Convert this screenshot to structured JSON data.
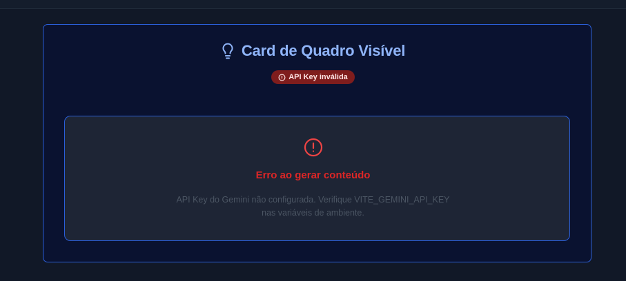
{
  "header": {
    "title": "Card de Quadro Visível",
    "title_icon": "lightbulb-icon"
  },
  "status_badge": {
    "label": "API Key inválida",
    "icon": "alert-circle-icon",
    "color": "#7f1d1d"
  },
  "error": {
    "icon": "alert-circle-icon",
    "title": "Erro ao gerar conteúdo",
    "message_line1": "API Key do Gemini não configurada. Verifique VITE_GEMINI_API_KEY",
    "message_line2": "nas variáveis de ambiente.",
    "color": "#dc2626"
  },
  "colors": {
    "background": "#111827",
    "card": "#0a1230",
    "accent_border": "#2b5fd9",
    "title": "#8fb4f8"
  }
}
